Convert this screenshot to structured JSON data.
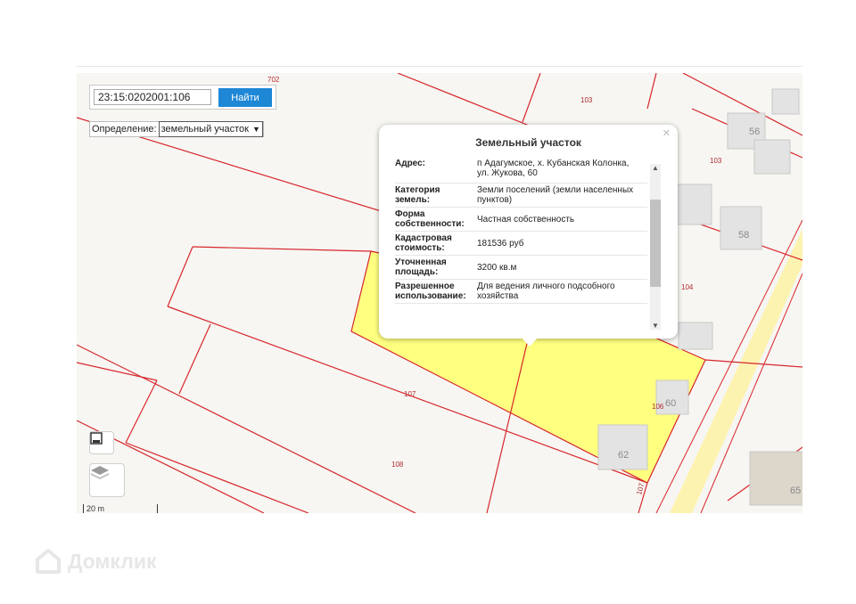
{
  "search": {
    "value": "23:15:0202001:106",
    "button_label": "Найти"
  },
  "definition": {
    "label": "Определение:",
    "selected": "земельный участок"
  },
  "popup": {
    "title": "Земельный участок",
    "rows": [
      {
        "key_line1": "Адрес:",
        "key_line2": "",
        "value_line1": "п Адагумское, х. Кубанская Колонка,",
        "value_line2": "ул. Жукова, 60"
      },
      {
        "key_line1": "Категория",
        "key_line2": "земель:",
        "value_line1": "Земли поселений (земли населенных",
        "value_line2": "пунктов)"
      },
      {
        "key_line1": "Форма",
        "key_line2": "собственности:",
        "value_line1": "Частная собственность",
        "value_line2": ""
      },
      {
        "key_line1": "Кадастровая",
        "key_line2": "стоимость:",
        "value_line1": "181536 руб",
        "value_line2": ""
      },
      {
        "key_line1": "Уточненная",
        "key_line2": "площадь:",
        "value_line1": "3200 кв.м",
        "value_line2": ""
      },
      {
        "key_line1": "Разрешенное",
        "key_line2": "использование:",
        "value_line1": "Для ведения личного подсобного",
        "value_line2": "хозяйства"
      }
    ]
  },
  "map_labels": {
    "l702": "702",
    "l103a": "103",
    "l103b": "103",
    "l104": "104",
    "l107a": "107",
    "l107b": "107",
    "l108": "108",
    "l106": "106",
    "b56": "56",
    "b58": "58",
    "b60": "60",
    "b62": "62",
    "b65": "65"
  },
  "scale_label": "20 m",
  "watermark": "Домклик",
  "colors": {
    "parcel_fill": "#ffff80",
    "boundary": "#d8262c",
    "button": "#1e87d6",
    "road": "#fdf3b0"
  },
  "icons": {
    "bookmark": "bookmark-icon",
    "layers": "layers-icon"
  }
}
